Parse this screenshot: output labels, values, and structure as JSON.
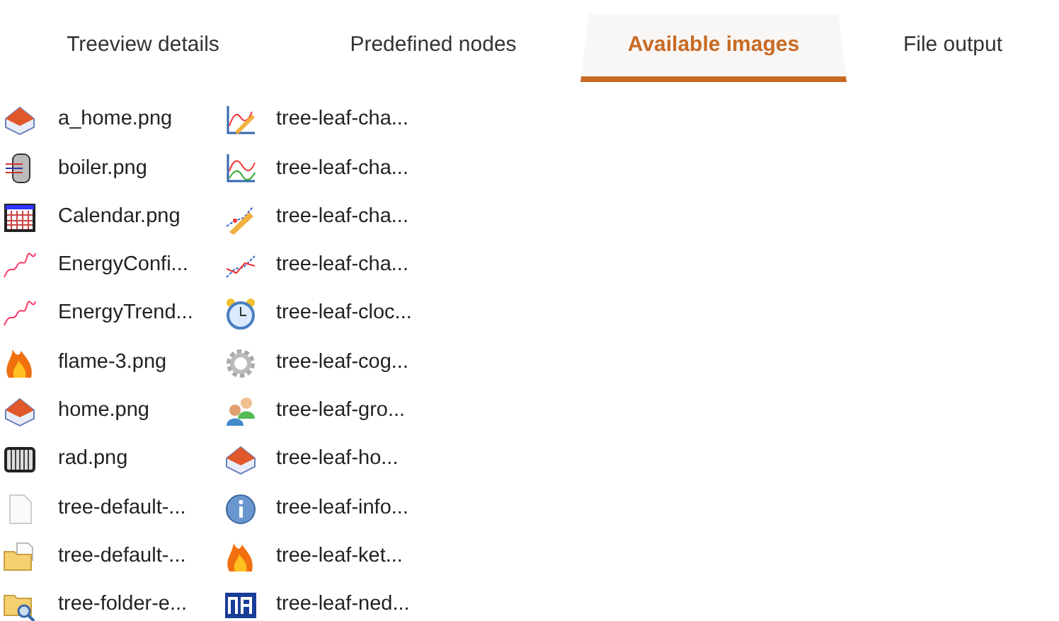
{
  "tabs": [
    {
      "label": "Treeview details",
      "selected": false
    },
    {
      "label": "Predefined nodes",
      "selected": false
    },
    {
      "label": "Available images",
      "selected": true
    },
    {
      "label": "File output",
      "selected": false
    }
  ],
  "image_columns": [
    [
      {
        "kind": "house",
        "label": "a_home.png"
      },
      {
        "kind": "boiler",
        "label": "boiler.png"
      },
      {
        "kind": "calendar",
        "label": "Calendar.png"
      },
      {
        "kind": "trend",
        "label": "EnergyConfi..."
      },
      {
        "kind": "trend",
        "label": "EnergyTrend..."
      },
      {
        "kind": "flame",
        "label": "flame-3.png"
      },
      {
        "kind": "house",
        "label": "home.png"
      },
      {
        "kind": "radiator",
        "label": "rad.png"
      },
      {
        "kind": "page",
        "label": "tree-default-..."
      },
      {
        "kind": "folder",
        "label": "tree-default-..."
      },
      {
        "kind": "search",
        "label": "tree-folder-e..."
      }
    ],
    [
      {
        "kind": "sketch",
        "label": "tree-leaf-cha..."
      },
      {
        "kind": "chart",
        "label": "tree-leaf-cha..."
      },
      {
        "kind": "pencil",
        "label": "tree-leaf-cha..."
      },
      {
        "kind": "line",
        "label": "tree-leaf-cha..."
      },
      {
        "kind": "clock",
        "label": "tree-leaf-cloc..."
      },
      {
        "kind": "gear",
        "label": "tree-leaf-cog..."
      },
      {
        "kind": "people",
        "label": "tree-leaf-gro..."
      },
      {
        "kind": "house",
        "label": "tree-leaf-ho..."
      },
      {
        "kind": "info",
        "label": "tree-leaf-info..."
      },
      {
        "kind": "flame",
        "label": "tree-leaf-ket..."
      },
      {
        "kind": "logo",
        "label": "tree-leaf-ned..."
      }
    ]
  ]
}
